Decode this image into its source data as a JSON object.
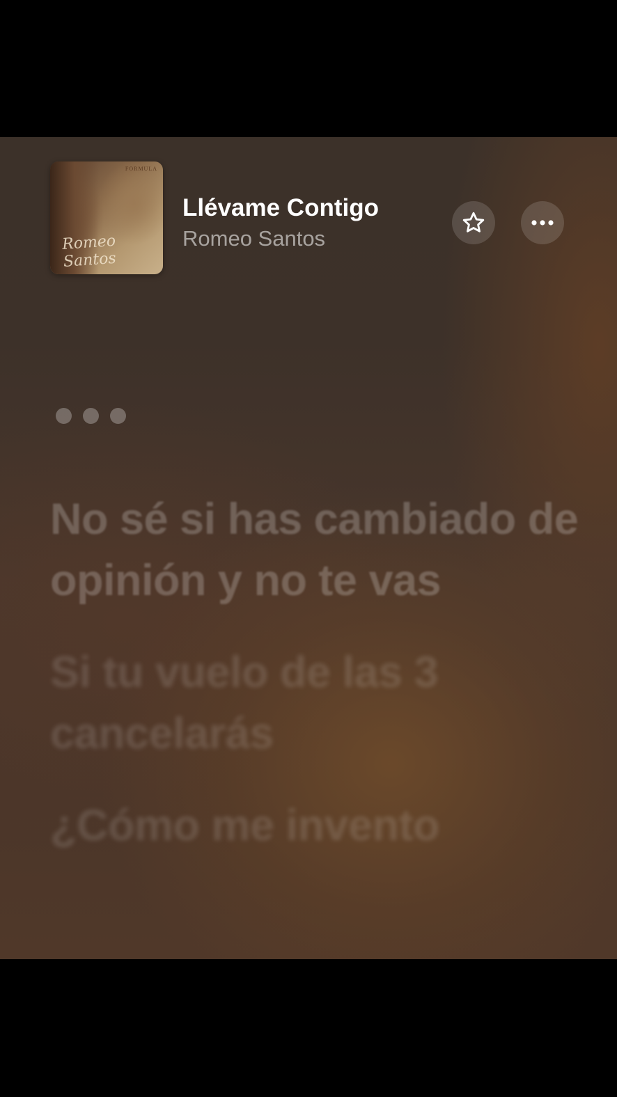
{
  "now_playing": {
    "title": "Llévame Contigo",
    "artist": "Romeo Santos",
    "album_art": {
      "series_text": "FORMULA",
      "art_text": "Romeo Santos"
    }
  },
  "controls": {
    "favorite_icon": "star-outline-icon",
    "more_icon": "ellipsis-icon"
  },
  "lyrics": {
    "interlude_indicator": "•••",
    "lines": [
      "No sé si has cambiado de opinión y no te vas",
      "Si tu vuelo de las 3 cancelarás",
      "¿Cómo me invento"
    ]
  },
  "colors": {
    "background_dark": "#3c3129",
    "background_warm": "#704c2a",
    "title": "#ffffff",
    "artist": "#9a918b"
  }
}
